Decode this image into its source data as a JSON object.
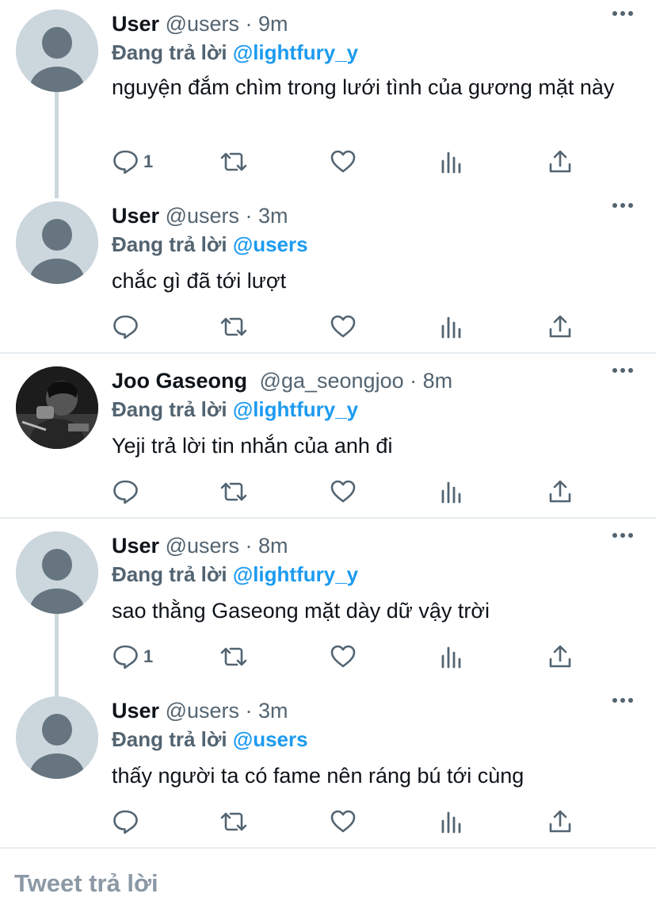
{
  "replying_label": "Đang trả lời",
  "reply_placeholder": "Tweet trả lời",
  "tweets": [
    {
      "name": "User",
      "handle": "@users",
      "time": "· 9m",
      "mention": "@lightfury_y",
      "text": "nguyện đắm chìm trong lưới tình của gương mặt này",
      "reply_count": "1"
    },
    {
      "name": "User",
      "handle": "@users",
      "time": "· 3m",
      "mention": "@users",
      "text": "chắc gì đã tới lượt",
      "reply_count": ""
    },
    {
      "name": "Joo Gaseong",
      "handle": "@ga_seongjoo",
      "time": "· 8m",
      "mention": "@lightfury_y",
      "text": "Yeji trả lời tin nhắn của anh đi",
      "reply_count": ""
    },
    {
      "name": "User",
      "handle": "@users",
      "time": "· 8m",
      "mention": "@lightfury_y",
      "text": "sao thằng Gaseong mặt dày dữ vậy trời",
      "reply_count": "1"
    },
    {
      "name": "User",
      "handle": "@users",
      "time": "· 3m",
      "mention": "@users",
      "text": "thấy người ta có fame nên ráng bú tới cùng",
      "reply_count": ""
    }
  ]
}
